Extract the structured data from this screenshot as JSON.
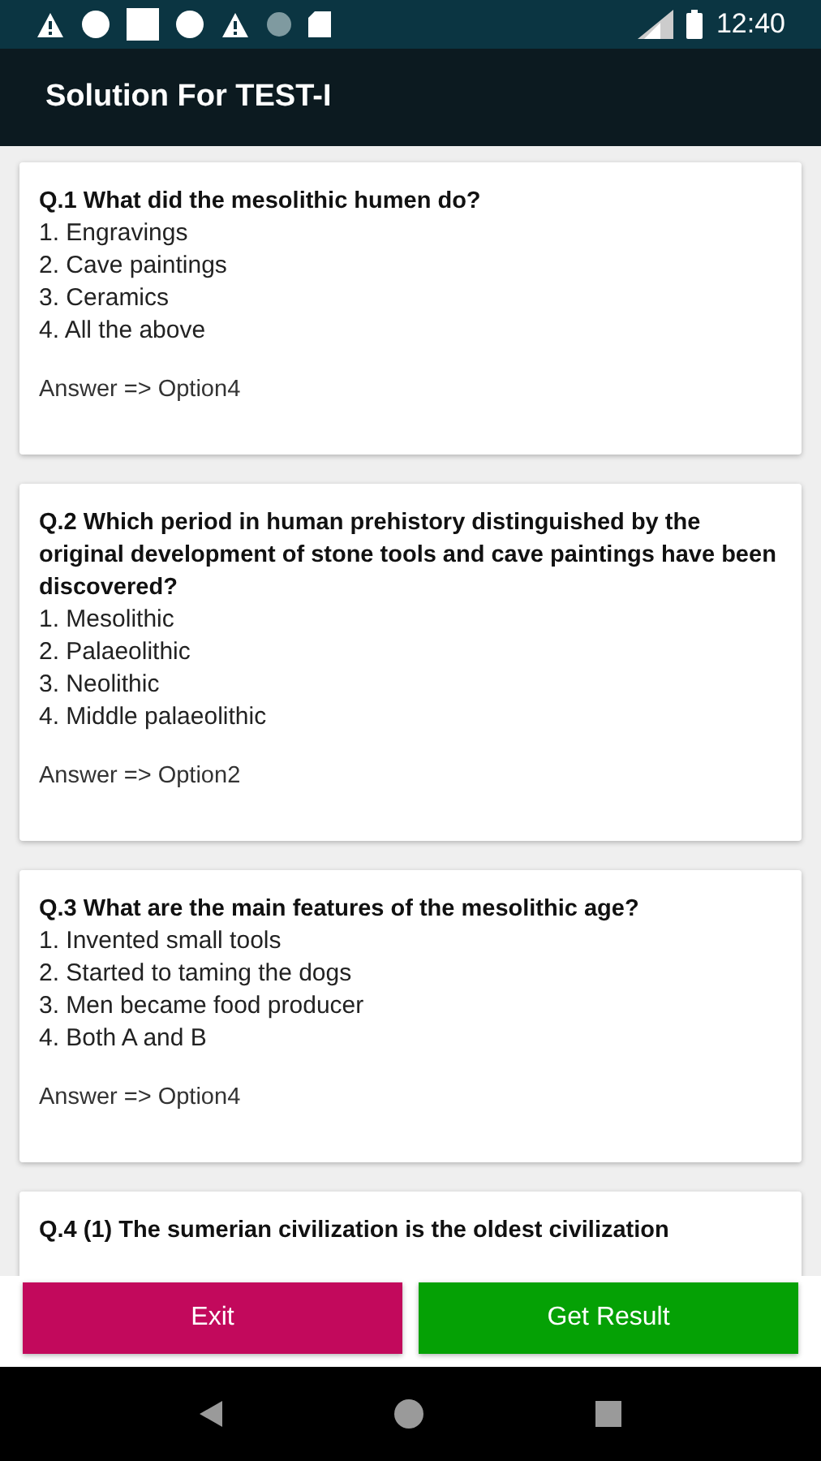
{
  "status_bar": {
    "time": "12:40"
  },
  "app_bar": {
    "title": "Solution For TEST-I"
  },
  "questions": [
    {
      "question": "Q.1  What did the mesolithic humen do?",
      "options": [
        "1. Engravings",
        "2. Cave paintings",
        "3. Ceramics",
        "4. All the above"
      ],
      "answer": "Answer => Option4"
    },
    {
      "question": "Q.2  Which period in human prehistory distinguished by the original development of stone tools and cave paintings have been discovered?",
      "options": [
        "1. Mesolithic",
        "2. Palaeolithic",
        "3. Neolithic",
        "4. Middle palaeolithic"
      ],
      "answer": "Answer => Option2"
    },
    {
      "question": "Q.3  What are the main features of the mesolithic age?",
      "options": [
        "1. Invented small tools",
        "2. Started to taming the dogs",
        "3. Men became food producer",
        "4. Both A and B"
      ],
      "answer": "Answer => Option4"
    },
    {
      "question": "Q.4  (1) The sumerian civilization is the oldest civilization"
    }
  ],
  "buttons": [
    {
      "label": "Exit",
      "color": "#c2095c"
    },
    {
      "label": "Get Result",
      "color": "#05a105"
    }
  ]
}
